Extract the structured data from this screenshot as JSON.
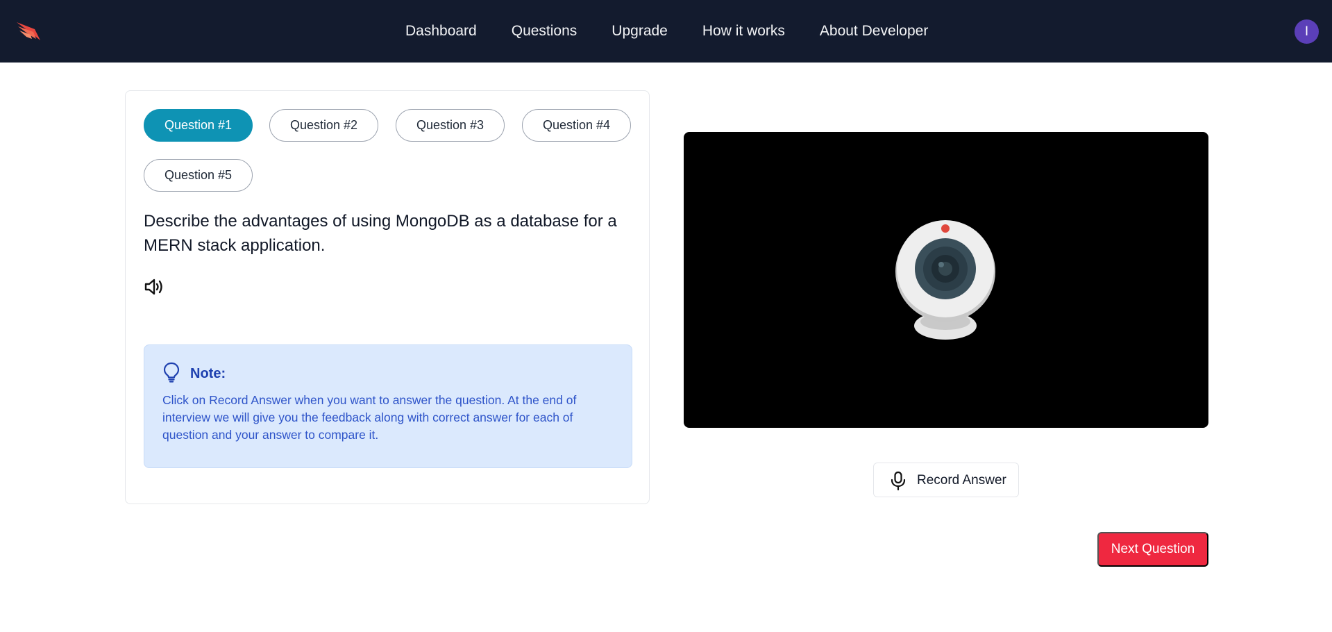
{
  "nav": {
    "links": [
      "Dashboard",
      "Questions",
      "Upgrade",
      "How it works",
      "About Developer"
    ],
    "avatar_initial": "I",
    "logo_icon": "bird-wing-logo"
  },
  "questions": {
    "tabs": [
      "Question #1",
      "Question #2",
      "Question #3",
      "Question #4",
      "Question #5"
    ],
    "active_index": 0,
    "current_text": "Describe the advantages of using MongoDB as a database for a MERN stack application."
  },
  "note": {
    "title": "Note:",
    "body": "Click on Record Answer when you want to answer the question. At the end of interview we will give you the feedback along with correct answer for each of question and your answer to compare it."
  },
  "record": {
    "label": "Record Answer"
  },
  "next": {
    "label": "Next Question"
  },
  "colors": {
    "navbar": "#131b2e",
    "active_tab": "#0e93b4",
    "next_button": "#ef2840",
    "note_bg": "#dbe9fd",
    "avatar": "#5b3fb8"
  }
}
